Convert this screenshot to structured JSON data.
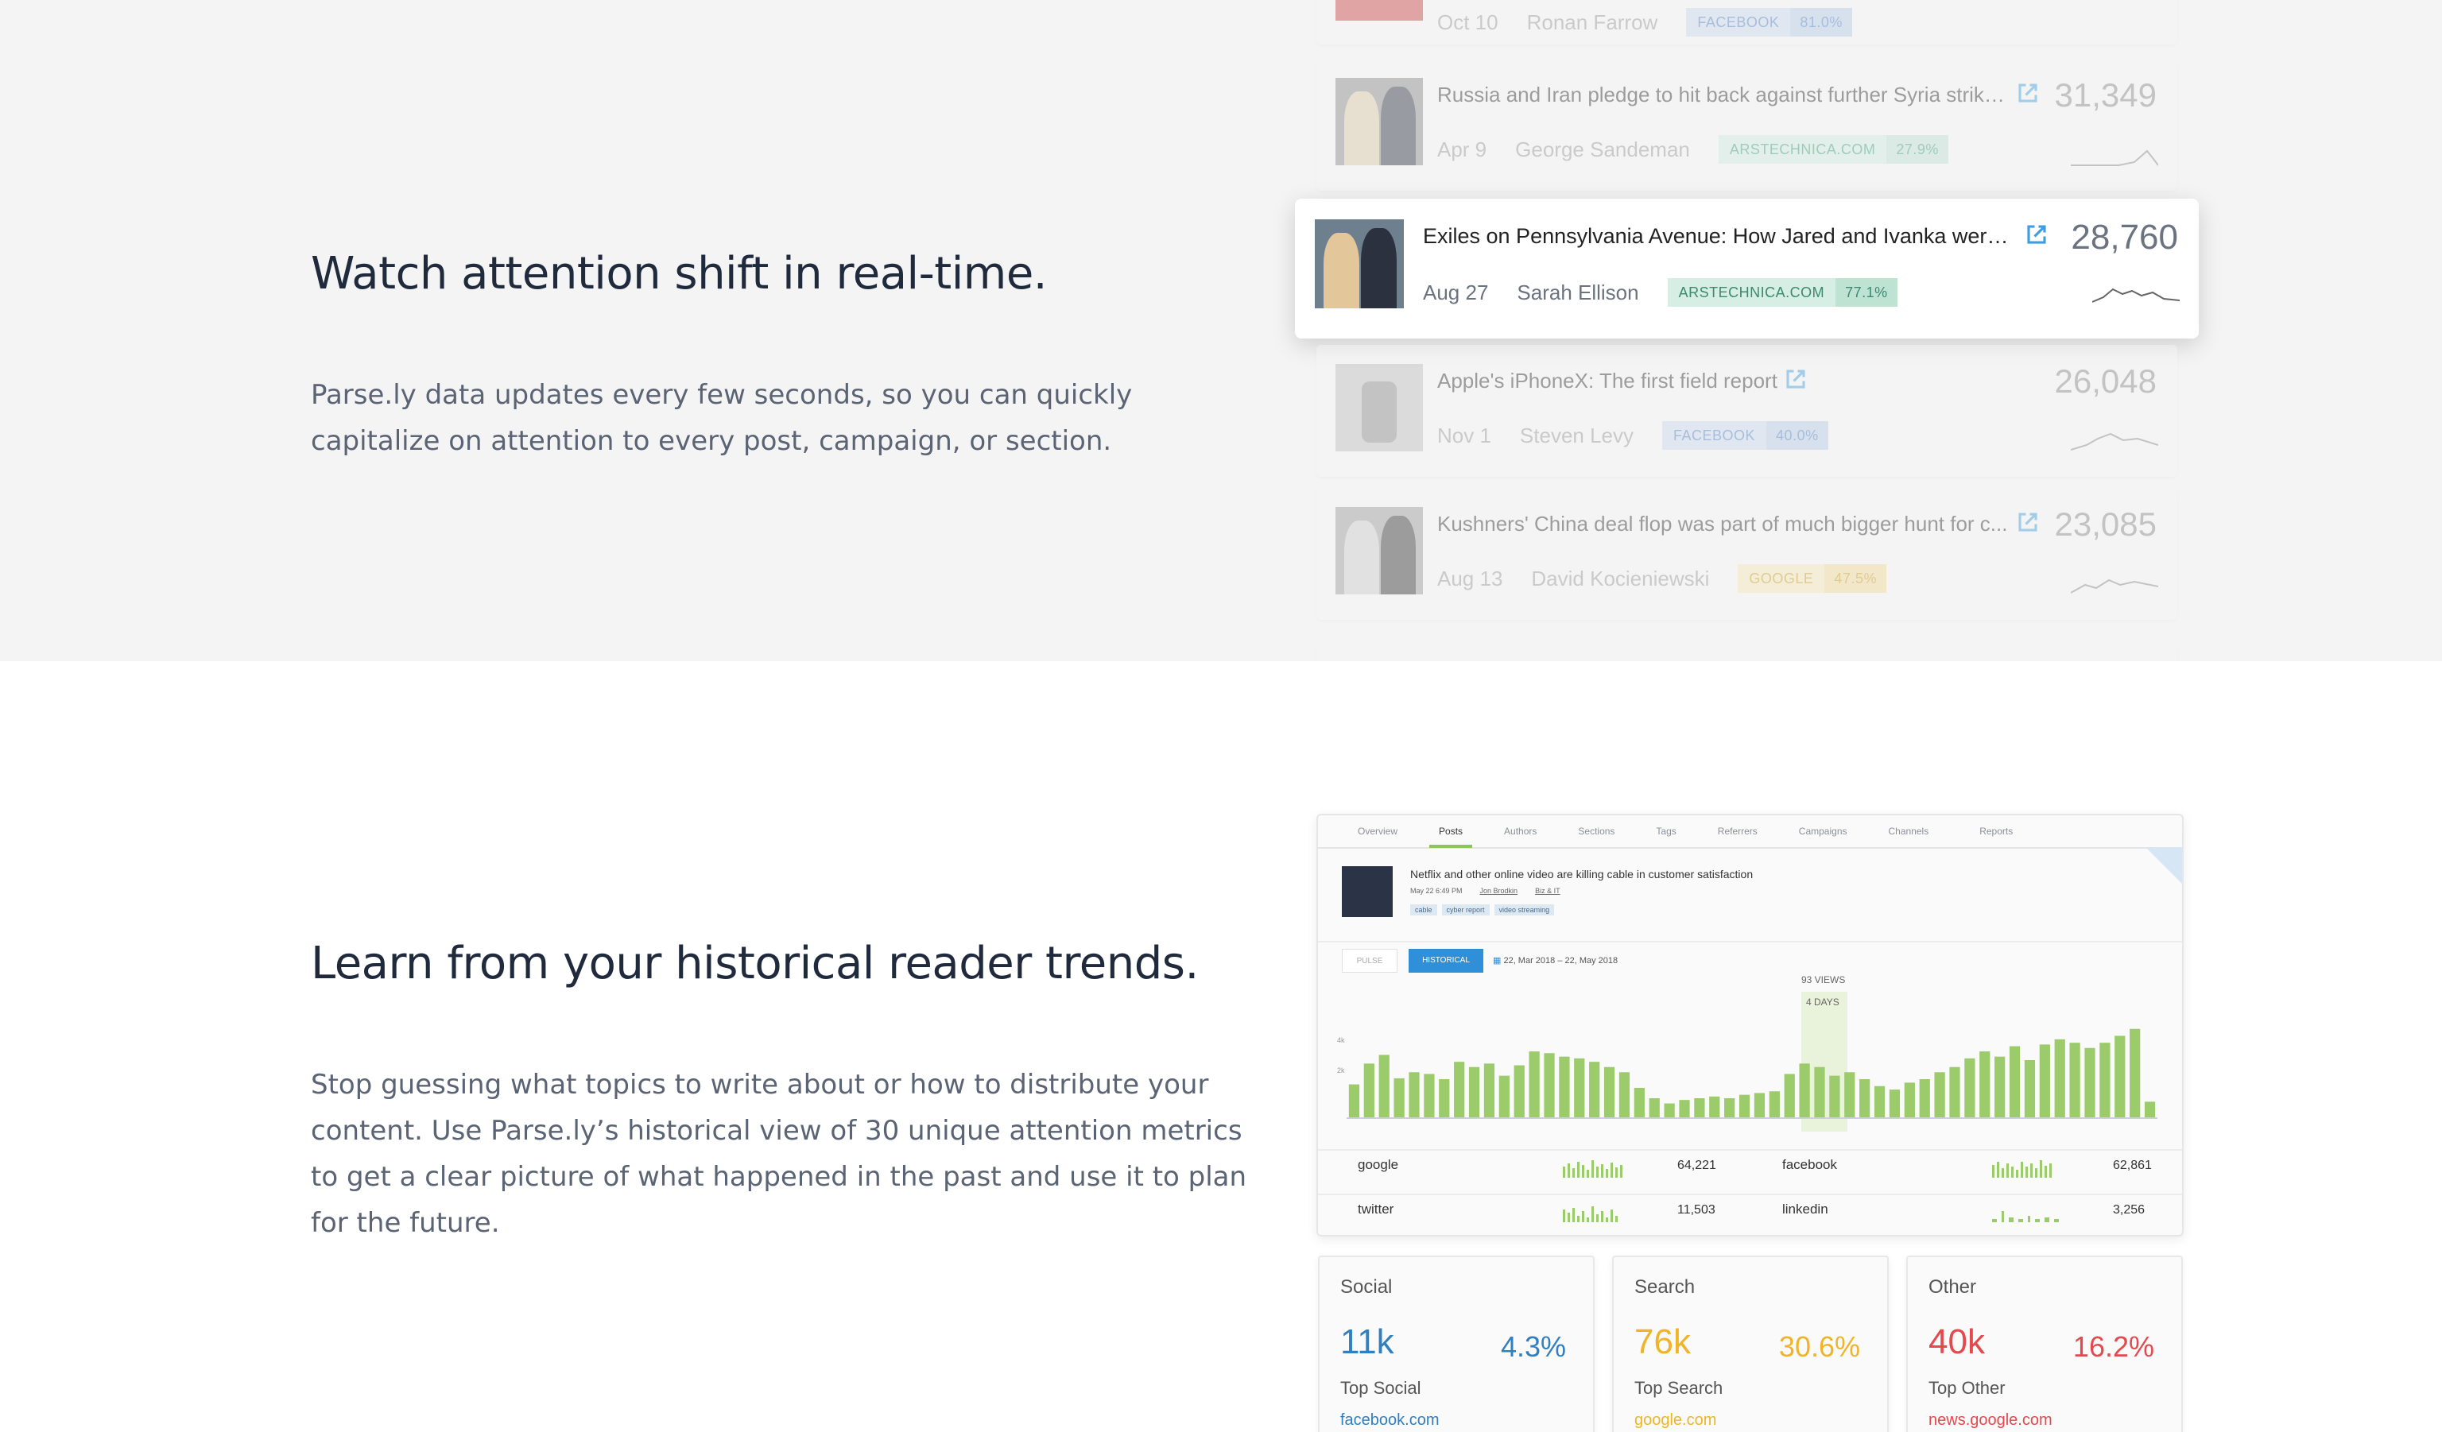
{
  "section1": {
    "heading": "Watch attention shift in real-time.",
    "paragraph_line1": "Parse.ly data updates every few seconds, so you can quickly",
    "paragraph_line2": "capitalize on attention to every post, campaign, or section."
  },
  "posts": [
    {
      "date": "Oct 10",
      "author": "Ronan Farrow",
      "title": "",
      "views": "",
      "source": "FACEBOOK",
      "share": "81.0%",
      "source_color": "#c8d8ef"
    },
    {
      "date": "Apr 9",
      "author": "George Sandeman",
      "title": "Russia and Iran pledge to hit back against further Syria strike...",
      "views": "31,349",
      "source": "ARSTECHNICA.COM",
      "share": "27.9%",
      "source_color": "#cfe9df"
    },
    {
      "date": "Aug 27",
      "author": "Sarah Ellison",
      "title": "Exiles on Pennsylvania Avenue: How Jared and Ivanka were r...",
      "views": "28,760",
      "source": "ARSTECHNICA.COM",
      "share": "77.1%",
      "source_color": "#cfe9df"
    },
    {
      "date": "Nov 1",
      "author": "Steven Levy",
      "title": "Apple's iPhoneX: The first field report",
      "views": "26,048",
      "source": "FACEBOOK",
      "share": "40.0%",
      "source_color": "#c8d8ef"
    },
    {
      "date": "Aug 13",
      "author": "David Kocieniewski",
      "title": "Kushners' China deal flop was part of much bigger hunt for c...",
      "views": "23,085",
      "source": "GOOGLE",
      "share": "47.5%",
      "source_color": "#f6e5b4"
    }
  ],
  "section2": {
    "heading": "Learn from your historical reader trends.",
    "paragraph_line1": "Stop guessing what topics to write about or how to distribute your",
    "paragraph_line2": "content. Use Parse.ly’s historical view of 30 unique attention metrics",
    "paragraph_line3": "to get a clear picture of what happened in the past and use it to plan",
    "paragraph_line4": "for the future."
  },
  "dashboard": {
    "tabs": [
      "Overview",
      "Posts",
      "Authors",
      "Sections",
      "Tags",
      "Referrers",
      "Campaigns",
      "Channels",
      "Reports"
    ],
    "active_tab": "Posts",
    "post_title": "Netflix and other online video are killing cable in customer satisfaction",
    "post_date": "May 22 6:49 PM",
    "post_author1": "Jon Brodkin",
    "post_author2": "Biz & IT",
    "tags": [
      "cable",
      "cyber report",
      "video streaming"
    ],
    "mode_pulse": "PULSE",
    "mode_historical": "HISTORICAL",
    "date_range": "22, Mar 2018 – 22, May 2018",
    "tooltip_views": "93 VIEWS",
    "tooltip_days": "4 DAYS",
    "ytick_top": "4k",
    "ytick_mid": "2k",
    "referrers": [
      {
        "name": "google",
        "value": "64,221"
      },
      {
        "name": "facebook",
        "value": "62,861"
      },
      {
        "name": "twitter",
        "value": "11,503"
      },
      {
        "name": "linkedin",
        "value": "3,256"
      }
    ]
  },
  "chart_data": {
    "type": "bar",
    "values": [
      38,
      62,
      72,
      45,
      52,
      50,
      44,
      64,
      58,
      62,
      48,
      60,
      76,
      74,
      70,
      68,
      64,
      58,
      52,
      34,
      22,
      16,
      20,
      22,
      24,
      22,
      26,
      28,
      30,
      50,
      62,
      58,
      48,
      52,
      44,
      36,
      32,
      40,
      44,
      52,
      58,
      68,
      76,
      70,
      82,
      66,
      84,
      90,
      86,
      80,
      86,
      94,
      102,
      18
    ],
    "title": "",
    "xlabel": "",
    "ylabel": ""
  },
  "stats": [
    {
      "label": "Social",
      "value": "11k",
      "pct": "4.3%",
      "top_label": "Top Social",
      "top_value": "facebook.com",
      "color": "#2f7fc1"
    },
    {
      "label": "Search",
      "value": "76k",
      "pct": "30.6%",
      "top_label": "Top Search",
      "top_value": "google.com",
      "color": "#f0b429"
    },
    {
      "label": "Other",
      "value": "40k",
      "pct": "16.2%",
      "top_label": "Top Other",
      "top_value": "news.google.com",
      "color": "#e5484d"
    }
  ],
  "colors": {
    "bar_green": "#9bcb6b",
    "historical_blue": "#2f8fd8",
    "link_blue": "#3d9ee0"
  }
}
